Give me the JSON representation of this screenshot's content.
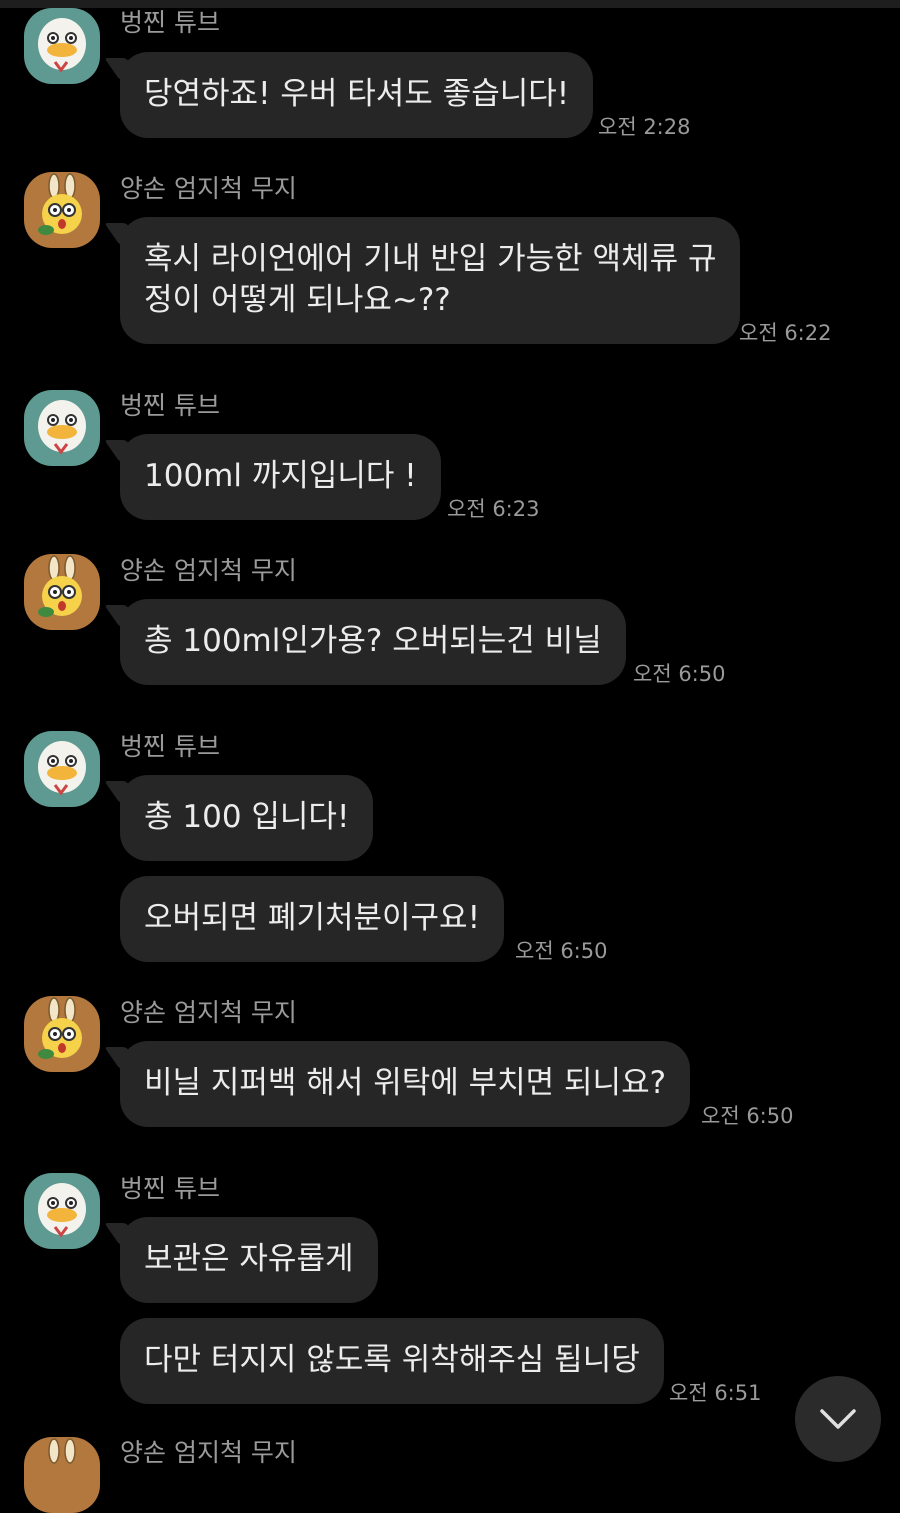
{
  "senders": {
    "tube": "벙찐 튜브",
    "muzi": "양손 엄지척 무지"
  },
  "colors": {
    "background": "#000000",
    "bubble": "#262626",
    "text": "#ececec",
    "meta_text": "#9a9a9a",
    "tube_avatar_bg": "#5e9a91",
    "muzi_avatar_bg": "#b2783e"
  },
  "messages": [
    {
      "sender": "벙찐 튜브",
      "avatar": "tube-avatar",
      "lines": [
        "당연하죠! 우버 타셔도 좋습니다!"
      ],
      "time": "오전 2:28"
    },
    {
      "sender": "양손 엄지척 무지",
      "avatar": "muzi-avatar",
      "lines": [
        "혹시 라이언에어 기내 반입 가능한 액체류 규",
        "정이 어떻게 되나요~??"
      ],
      "time": "오전 6:22"
    },
    {
      "sender": "벙찐 튜브",
      "avatar": "tube-avatar",
      "lines": [
        "100ml 까지입니다 !"
      ],
      "time": "오전 6:23"
    },
    {
      "sender": "양손 엄지척 무지",
      "avatar": "muzi-avatar",
      "lines": [
        "총 100ml인가용? 오버되는건 비닐"
      ],
      "time": "오전 6:50"
    },
    {
      "sender": "벙찐 튜브",
      "avatar": "tube-avatar",
      "lines": [
        "총 100 입니다!"
      ],
      "time": ""
    },
    {
      "sender": "",
      "avatar": "",
      "lines": [
        "오버되면 폐기처분이구요!"
      ],
      "time": "오전 6:50"
    },
    {
      "sender": "양손 엄지척 무지",
      "avatar": "muzi-avatar",
      "lines": [
        "비닐 지퍼백 해서 위탁에 부치면 되니요?"
      ],
      "time": "오전 6:50"
    },
    {
      "sender": "벙찐 튜브",
      "avatar": "tube-avatar",
      "lines": [
        "보관은 자유롭게"
      ],
      "time": ""
    },
    {
      "sender": "",
      "avatar": "",
      "lines": [
        "다만 터지지 않도록 위착해주심 됩니당"
      ],
      "time": "오전 6:51"
    },
    {
      "sender": "양손 엄지척 무지",
      "avatar": "muzi-avatar",
      "lines": [],
      "time": ""
    }
  ],
  "scroll_button_icon": "chevron-down-icon"
}
